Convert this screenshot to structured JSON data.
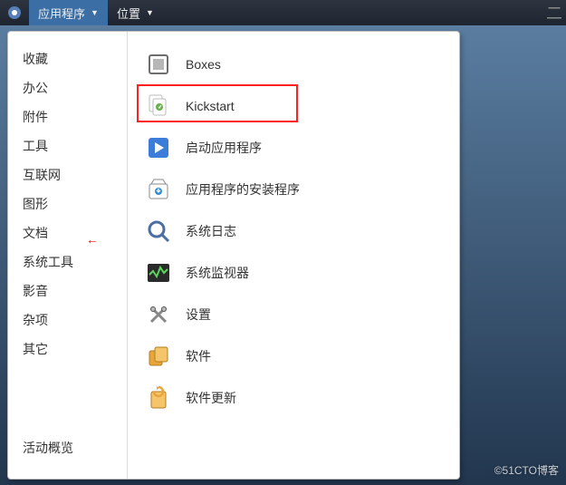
{
  "topbar": {
    "applications": "应用程序",
    "places": "位置"
  },
  "categories": {
    "favorites": "收藏",
    "office": "办公",
    "accessories": "附件",
    "tools": "工具",
    "internet": "互联网",
    "graphics": "图形",
    "documentation": "文档",
    "system_tools": "系统工具",
    "sound_video": "影音",
    "sundry": "杂项",
    "other": "其它",
    "activities": "活动概览"
  },
  "apps": {
    "boxes": "Boxes",
    "kickstart": "Kickstart",
    "startup": "启动应用程序",
    "software_installer": "应用程序的安装程序",
    "logs": "系统日志",
    "system_monitor": "系统监视器",
    "settings": "设置",
    "software": "软件",
    "software_update": "软件更新"
  },
  "watermark": "©51CTO博客"
}
